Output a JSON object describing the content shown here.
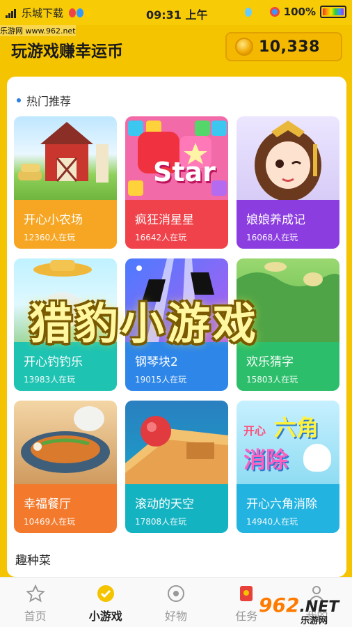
{
  "status": {
    "carrier": "乐城下载",
    "time": "09:31 上午",
    "battery": "100%"
  },
  "header": {
    "title": "玩游戏赚幸运币",
    "coins": "10,338"
  },
  "section": {
    "title": "热门推荐"
  },
  "games": [
    {
      "name": "开心小农场",
      "players": "12360人在玩",
      "color": "#f7a623"
    },
    {
      "name": "疯狂消星星",
      "players": "16642人在玩",
      "color": "#f0424a"
    },
    {
      "name": "娘娘养成记",
      "players": "16068人在玩",
      "color": "#8b3de0"
    },
    {
      "name": "开心钓钓乐",
      "players": "13983人在玩",
      "color": "#1ec3b2"
    },
    {
      "name": "钢琴块2",
      "players": "19015人在玩",
      "color": "#2d86e8"
    },
    {
      "name": "欢乐猜字",
      "players": "15803人在玩",
      "color": "#2cbe6a"
    },
    {
      "name": "幸福餐厅",
      "players": "10469人在玩",
      "color": "#f37a2c"
    },
    {
      "name": "滚动的天空",
      "players": "17808人在玩",
      "color": "#14b3c2"
    },
    {
      "name": "开心六角消除",
      "players": "14940人在玩",
      "color": "#23b3e0"
    }
  ],
  "art_text": {
    "star": "Star",
    "hex_line1": "开心",
    "hex_line2": "六角",
    "hex_line3": "消除"
  },
  "more": {
    "title": "趣种菜"
  },
  "watermark": "猎豹小游戏",
  "tabs": [
    {
      "label": "首页",
      "icon": "star-icon"
    },
    {
      "label": "小游戏",
      "icon": "gamepad-check-icon"
    },
    {
      "label": "好物",
      "icon": "target-icon"
    },
    {
      "label": "任务",
      "icon": "red-envelope-icon"
    },
    {
      "label": "我的",
      "icon": "person-icon"
    }
  ],
  "credits": {
    "site": "乐游网 www.962.net",
    "logo_962": "962",
    "logo_net": ".NET",
    "logo_sub": "乐游网"
  }
}
